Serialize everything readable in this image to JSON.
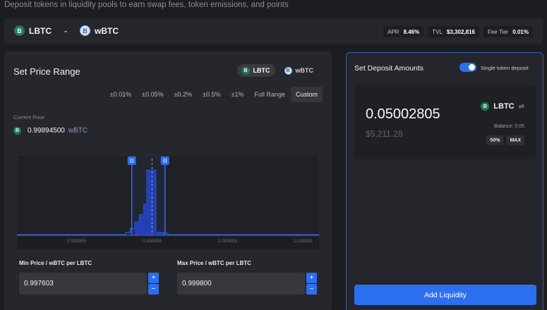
{
  "subtitle": "Deposit tokens in liquidity pools to earn swap fees, token emissions, and points",
  "pair": {
    "token0": "LBTC",
    "separator": "-",
    "token1": "wBTC",
    "token0_icon": "lbtc-icon",
    "token1_icon": "wbtc-icon"
  },
  "stats": [
    {
      "label": "APR",
      "value": "8.46%"
    },
    {
      "label": "TVL",
      "value": "$3,302,816"
    },
    {
      "label": "Fee Tier",
      "value": "0.01%"
    }
  ],
  "price_range": {
    "title": "Set Price Range",
    "token_toggle": [
      {
        "label": "LBTC",
        "active": true
      },
      {
        "label": "wBTC",
        "active": false
      }
    ],
    "range_tabs": [
      "±0.01%",
      "±0.05%",
      "±0.2%",
      "±0.5%",
      "±1%",
      "Full Range",
      "Custom"
    ],
    "active_tab": "Custom",
    "current_price_label": "Current Price",
    "current_price": "0.99894500",
    "current_price_unit": "wBTC"
  },
  "chart_data": {
    "type": "area",
    "x_ticks": [
      "0.993955",
      "0.998955",
      "1.003955",
      "1.008935"
    ],
    "current_price": 0.998945,
    "selected_range": [
      0.997603,
      0.9998
    ],
    "liquidity": [
      {
        "x": 0.99,
        "y": 1
      },
      {
        "x": 0.997,
        "y": 1
      },
      {
        "x": 0.9972,
        "y": 4
      },
      {
        "x": 0.9975,
        "y": 9
      },
      {
        "x": 0.9978,
        "y": 18
      },
      {
        "x": 0.9981,
        "y": 28
      },
      {
        "x": 0.9984,
        "y": 42
      },
      {
        "x": 0.9986,
        "y": 88
      },
      {
        "x": 0.999,
        "y": 88
      },
      {
        "x": 0.9992,
        "y": 4
      },
      {
        "x": 0.9998,
        "y": 3
      },
      {
        "x": 1.0,
        "y": 1
      },
      {
        "x": 1.01,
        "y": 1
      }
    ]
  },
  "min_price": {
    "label": "Min Price / wBTC per LBTC",
    "value": "0.997603"
  },
  "max_price": {
    "label": "Max Price / wBTC per LBTC",
    "value": "0.999800"
  },
  "deposit": {
    "title": "Set Deposit Amounts",
    "single_token_label": "Single token deposit",
    "single_token_enabled": true,
    "amount": "0.05002805",
    "usd": "$5,211.28",
    "token": "LBTC",
    "swap_icon": "swap-arrows-icon",
    "balance_label": "Balance:",
    "balance_value": "0.05",
    "pct_buttons": [
      "50%",
      "MAX"
    ],
    "submit_label": "Add Liquidity"
  },
  "colors": {
    "accent": "#2b6ff0",
    "background": "#1c1d21",
    "panel": "#26272c"
  }
}
